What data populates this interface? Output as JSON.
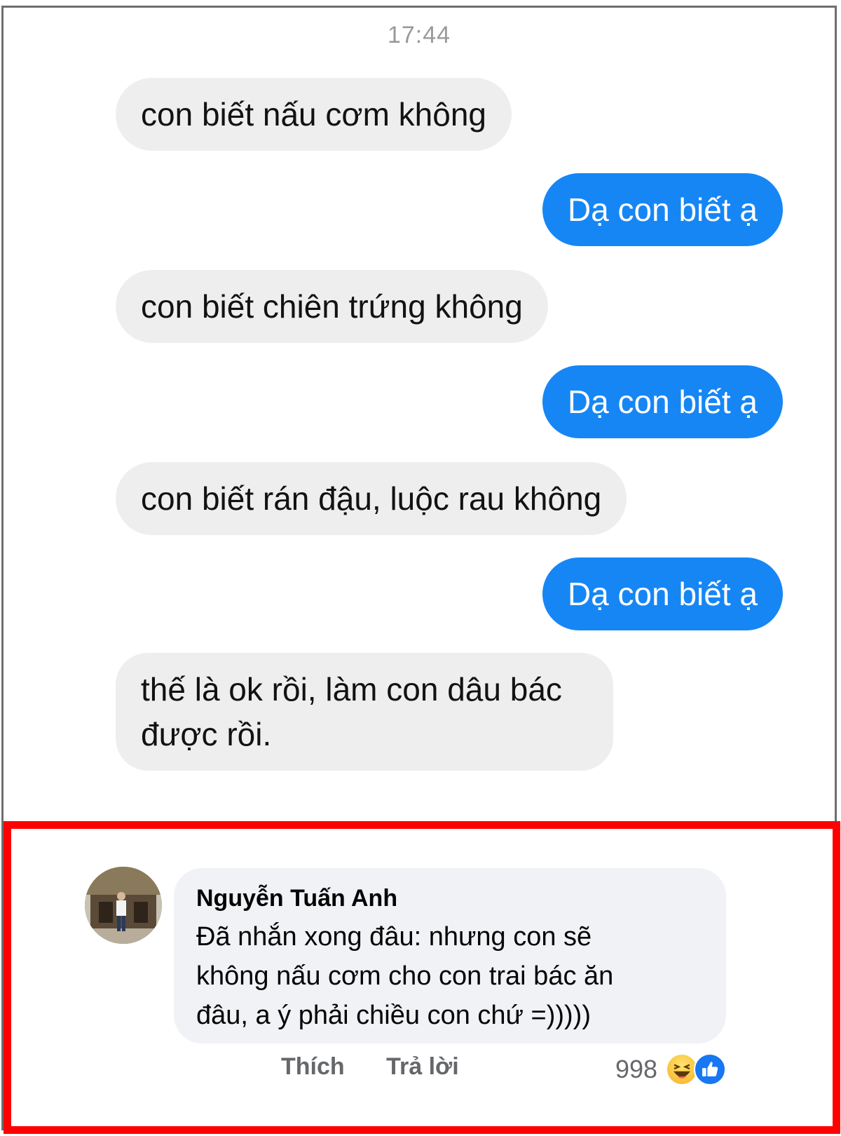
{
  "chat": {
    "timestamp": "17:44",
    "messages": [
      {
        "side": "in",
        "text": "con biết nấu cơm không"
      },
      {
        "side": "out",
        "text": "Dạ con biết ạ"
      },
      {
        "side": "in",
        "text": "con biết chiên trứng không"
      },
      {
        "side": "out",
        "text": "Dạ con biết ạ"
      },
      {
        "side": "in",
        "text": "con biết rán đậu, luộc rau không"
      },
      {
        "side": "out",
        "text": "Dạ con biết ạ"
      },
      {
        "side": "in",
        "line1": "thế là ok rồi, làm con dâu bác",
        "line2": "được rồi."
      }
    ]
  },
  "comment": {
    "author": "Nguyễn Tuấn Anh",
    "line1": "Đã nhắn xong đâu: nhưng con sẽ",
    "line2": "không nấu cơm cho con trai bác ăn",
    "line3": "đâu, a ý phải chiều con chứ =)))))",
    "like_label": "Thích",
    "reply_label": "Trả lời",
    "reaction_count": "998",
    "reaction_icons": [
      "haha-icon",
      "like-icon"
    ],
    "highlight_color": "#ff0000"
  }
}
